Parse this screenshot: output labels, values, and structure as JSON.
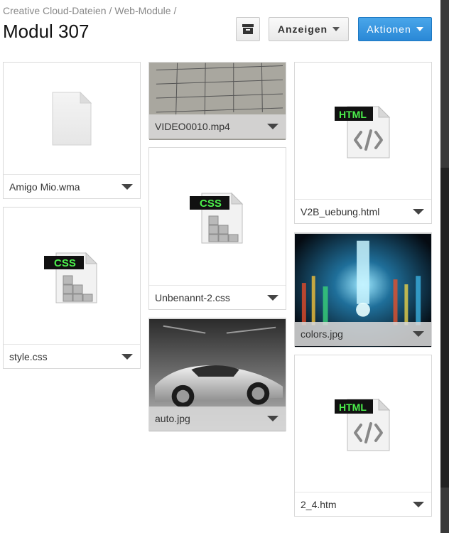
{
  "breadcrumb": {
    "items": [
      "Creative Cloud-Dateien",
      "Web-Module"
    ],
    "separator": "/"
  },
  "page_title": "Modul 307",
  "toolbar": {
    "archive_icon": "archive-icon",
    "show_label": "Anzeigen",
    "actions_label": "Aktionen"
  },
  "files": [
    {
      "name": "Amigo Mio.wma",
      "type": "generic-file-icon"
    },
    {
      "name": "style.css",
      "type": "css-file-icon",
      "badge": "CSS"
    },
    {
      "name": "VIDEO0010.mp4",
      "type": "video-thumbnail"
    },
    {
      "name": "Unbenannt-2.css",
      "type": "css-file-icon",
      "badge": "CSS"
    },
    {
      "name": "auto.jpg",
      "type": "image-thumbnail"
    },
    {
      "name": "V2B_uebung.html",
      "type": "html-file-icon",
      "badge": "HTML"
    },
    {
      "name": "colors.jpg",
      "type": "image-thumbnail"
    },
    {
      "name": "2_4.htm",
      "type": "html-file-icon",
      "badge": "HTML"
    }
  ],
  "colors": {
    "primary_button": "#2f8edb",
    "badge_green": "#4cf04c",
    "badge_bg": "#111111"
  }
}
